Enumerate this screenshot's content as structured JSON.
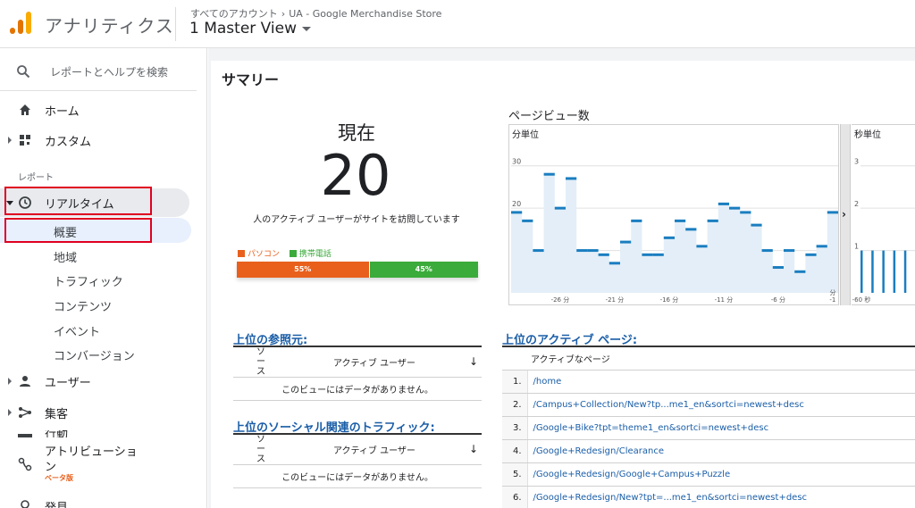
{
  "header": {
    "app_title": "アナリティクス",
    "breadcrumb": [
      "すべてのアカウント",
      "UA - Google Merchandise Store"
    ],
    "view_name": "1 Master View"
  },
  "sidebar": {
    "search_placeholder": "レポートとヘルプを検索",
    "home_label": "ホーム",
    "custom_label": "カスタム",
    "reports_heading": "レポート",
    "realtime_label": "リアルタイム",
    "realtime_sub": [
      "概要",
      "地域",
      "トラフィック",
      "コンテンツ",
      "イベント",
      "コンバージョン"
    ],
    "users_label": "ユーザー",
    "acquisition_label": "集客",
    "behavior_label": "行動",
    "attribution_label": "アトリビューション",
    "attribution_badge": "ベータ版",
    "discover_label": "発見"
  },
  "summary": {
    "title": "サマリー",
    "now_label": "現在",
    "active_users": "20",
    "caption": "人のアクティブ ユーザーがサイトを訪問しています",
    "devices": [
      {
        "label": "パソコン",
        "percent": 55,
        "percent_label": "55%",
        "color": "#e8601c"
      },
      {
        "label": "携帯電話",
        "percent": 45,
        "percent_label": "45%",
        "color": "#3bab3b"
      }
    ]
  },
  "pageviews": {
    "title": "ページビュー数",
    "per_minute_label": "分単位",
    "per_second_label": "秒単位"
  },
  "chart_data": [
    {
      "type": "bar",
      "title": "分単位",
      "xlabel": "分",
      "ylim": [
        0,
        35
      ],
      "yticks": [
        10,
        20,
        30
      ],
      "ytick_labels": [
        "10",
        "20",
        "30"
      ],
      "xticks": [
        -26,
        -21,
        -16,
        -11,
        -6,
        -1
      ],
      "xtick_labels": [
        "-26 分",
        "-21 分",
        "-16 分",
        "-11 分",
        "-6 分",
        "-1"
      ],
      "x": [
        -30,
        -29,
        -28,
        -27,
        -26,
        -25,
        -24,
        -23,
        -22,
        -21,
        -20,
        -19,
        -18,
        -17,
        -16,
        -15,
        -14,
        -13,
        -12,
        -11,
        -10,
        -9,
        -8,
        -7,
        -6,
        -5,
        -4,
        -3,
        -2,
        -1
      ],
      "values": [
        19,
        17,
        10,
        28,
        20,
        27,
        10,
        10,
        9,
        7,
        12,
        17,
        9,
        9,
        13,
        17,
        15,
        11,
        17,
        21,
        20,
        19,
        16,
        10,
        6,
        10,
        5,
        9,
        11,
        19
      ],
      "color": "#1a7ec0"
    },
    {
      "type": "bar",
      "title": "秒単位",
      "xlabel": "秒",
      "ylim": [
        0,
        3.5
      ],
      "yticks": [
        1,
        2,
        3
      ],
      "ytick_labels": [
        "1",
        "2",
        "3"
      ],
      "xticks": [
        -60
      ],
      "xtick_labels": [
        "-60 秒"
      ],
      "x": [
        -60,
        -55,
        -50,
        -45,
        -40
      ],
      "values": [
        1,
        1,
        1,
        1,
        1
      ],
      "color": "#1a7ec0"
    }
  ],
  "referrers": {
    "title": "上位の参照元:",
    "col_source": "ソース",
    "col_users": "アクティブ ユーザー",
    "empty_message": "このビューにはデータがありません。"
  },
  "social": {
    "title": "上位のソーシャル関連のトラフィック:",
    "col_source": "ソース",
    "col_users": "アクティブ ユーザー",
    "empty_message": "このビューにはデータがありません。"
  },
  "top_pages": {
    "title": "上位のアクティブ ページ:",
    "col_page": "アクティブなページ",
    "rows": [
      {
        "rank": "1.",
        "path": "/home"
      },
      {
        "rank": "2.",
        "path": "/Campus+Collection/New?tp...me1_en&sortci=newest+desc"
      },
      {
        "rank": "3.",
        "path": "/Google+Bike?tpt=theme1_en&sortci=newest+desc"
      },
      {
        "rank": "4.",
        "path": "/Google+Redesign/Clearance"
      },
      {
        "rank": "5.",
        "path": "/Google+Redesign/Google+Campus+Puzzle"
      },
      {
        "rank": "6.",
        "path": "/Google+Redesign/New?tpt=...me1_en&sortci=newest+desc"
      }
    ]
  }
}
